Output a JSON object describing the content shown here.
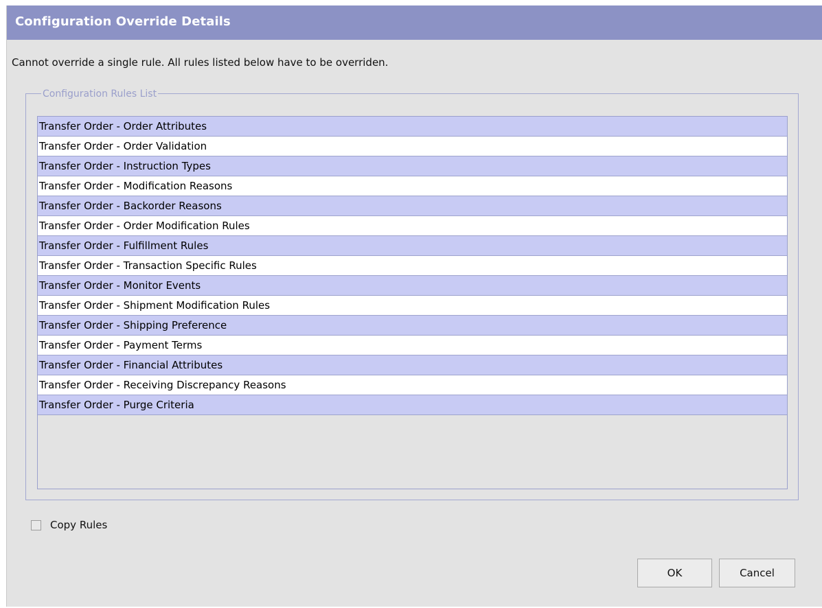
{
  "dialog": {
    "title": "Configuration Override Details",
    "message": "Cannot override a single rule. All rules listed below have to be overriden."
  },
  "rules_group": {
    "legend": "Configuration Rules List",
    "items": [
      "Transfer Order - Order Attributes",
      "Transfer Order - Order Validation",
      "Transfer Order - Instruction Types",
      "Transfer Order - Modification Reasons",
      "Transfer Order - Backorder Reasons",
      "Transfer Order - Order Modification Rules",
      "Transfer Order - Fulfillment Rules",
      "Transfer Order - Transaction Specific Rules",
      "Transfer Order - Monitor Events",
      "Transfer Order - Shipment Modification Rules",
      "Transfer Order - Shipping Preference",
      "Transfer Order - Payment Terms",
      "Transfer Order - Financial Attributes",
      "Transfer Order - Receiving Discrepancy Reasons",
      "Transfer Order - Purge Criteria"
    ]
  },
  "copy_rules": {
    "label": "Copy Rules",
    "checked": false
  },
  "buttons": {
    "ok_label": "OK",
    "cancel_label": "Cancel"
  },
  "colors": {
    "title_bar": "#8c92c5",
    "row_highlight": "#c8cbf4",
    "row_plain": "#ffffff",
    "dialog_background": "#e3e3e3"
  }
}
